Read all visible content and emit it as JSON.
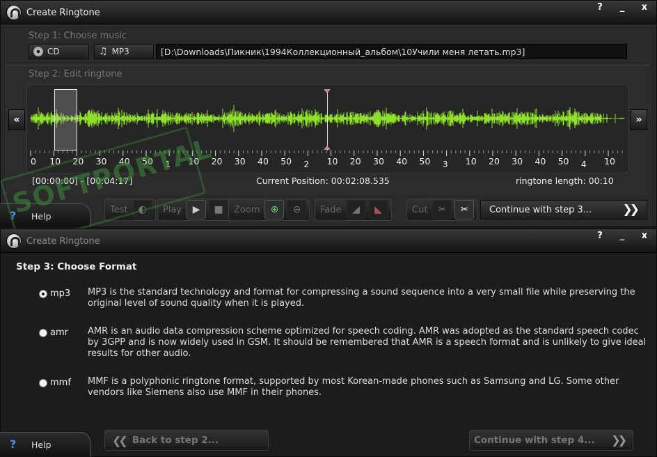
{
  "window1": {
    "title": "Create Ringtone",
    "controls": [
      "?",
      "_",
      "x"
    ],
    "step1": {
      "label": "Step 1: Choose music",
      "cd_label": "CD",
      "mp3_label": "MP3",
      "path": "[D:\\Downloads\\Пикник\\1994Коллекционный_альбом\\10Учили меня летать.mp3]"
    },
    "step2": {
      "label": "Step 2: Edit ringtone",
      "nav_left": "«",
      "nav_right": "»",
      "ruler_labels": [
        "0",
        "10",
        "20",
        "30",
        "40",
        "50",
        "1",
        "10",
        "20",
        "30",
        "40",
        "50",
        "2",
        "10",
        "20",
        "30",
        "40",
        "50",
        "3",
        "10",
        "20",
        "30",
        "40",
        "50",
        "4",
        "10"
      ],
      "selection_range": "[00:00:00] - [00:04:17]",
      "current_position": "Current Position: 00:02:08.535",
      "ringtone_length": "ringtone length: 00:10"
    },
    "toolbar": {
      "test": "Test",
      "play": "Play",
      "zoom": "Zoom",
      "fade": "Fade",
      "cut": "Cut",
      "continue": "Continue with step 3..."
    },
    "help": "Help",
    "watermark": "SOFTPORTAL"
  },
  "window2": {
    "title": "Create Ringtone",
    "controls": [
      "?",
      "_",
      "x"
    ],
    "step3_title": "Step 3: Choose Format",
    "formats": [
      {
        "id": "mp3",
        "label": "mp3",
        "checked": true,
        "desc": "MP3 is the standard technology and format for compressing a sound sequence into a very small file while preserving the original level of sound quality when it is played."
      },
      {
        "id": "amr",
        "label": "amr",
        "checked": false,
        "desc": "AMR is an audio data compression scheme optimized for speech coding. AMR was adopted as the standard speech codec by 3GPP and is now widely used in GSM. It should be remembered that AMR is a speech format and is unlikely to give ideal results for other audio."
      },
      {
        "id": "mmf",
        "label": "mmf",
        "checked": false,
        "desc": "MMF is a polyphonic ringtone format, supported by most Korean-made phones such as Samsung and LG. Some other vendors like Siemens also use MMF in their phones."
      }
    ],
    "back": "Back to step 2...",
    "continue": "Continue with step 4...",
    "help": "Help"
  },
  "colors": {
    "waveform": "#8ee02a",
    "help_icon": "#4a8ee0"
  }
}
